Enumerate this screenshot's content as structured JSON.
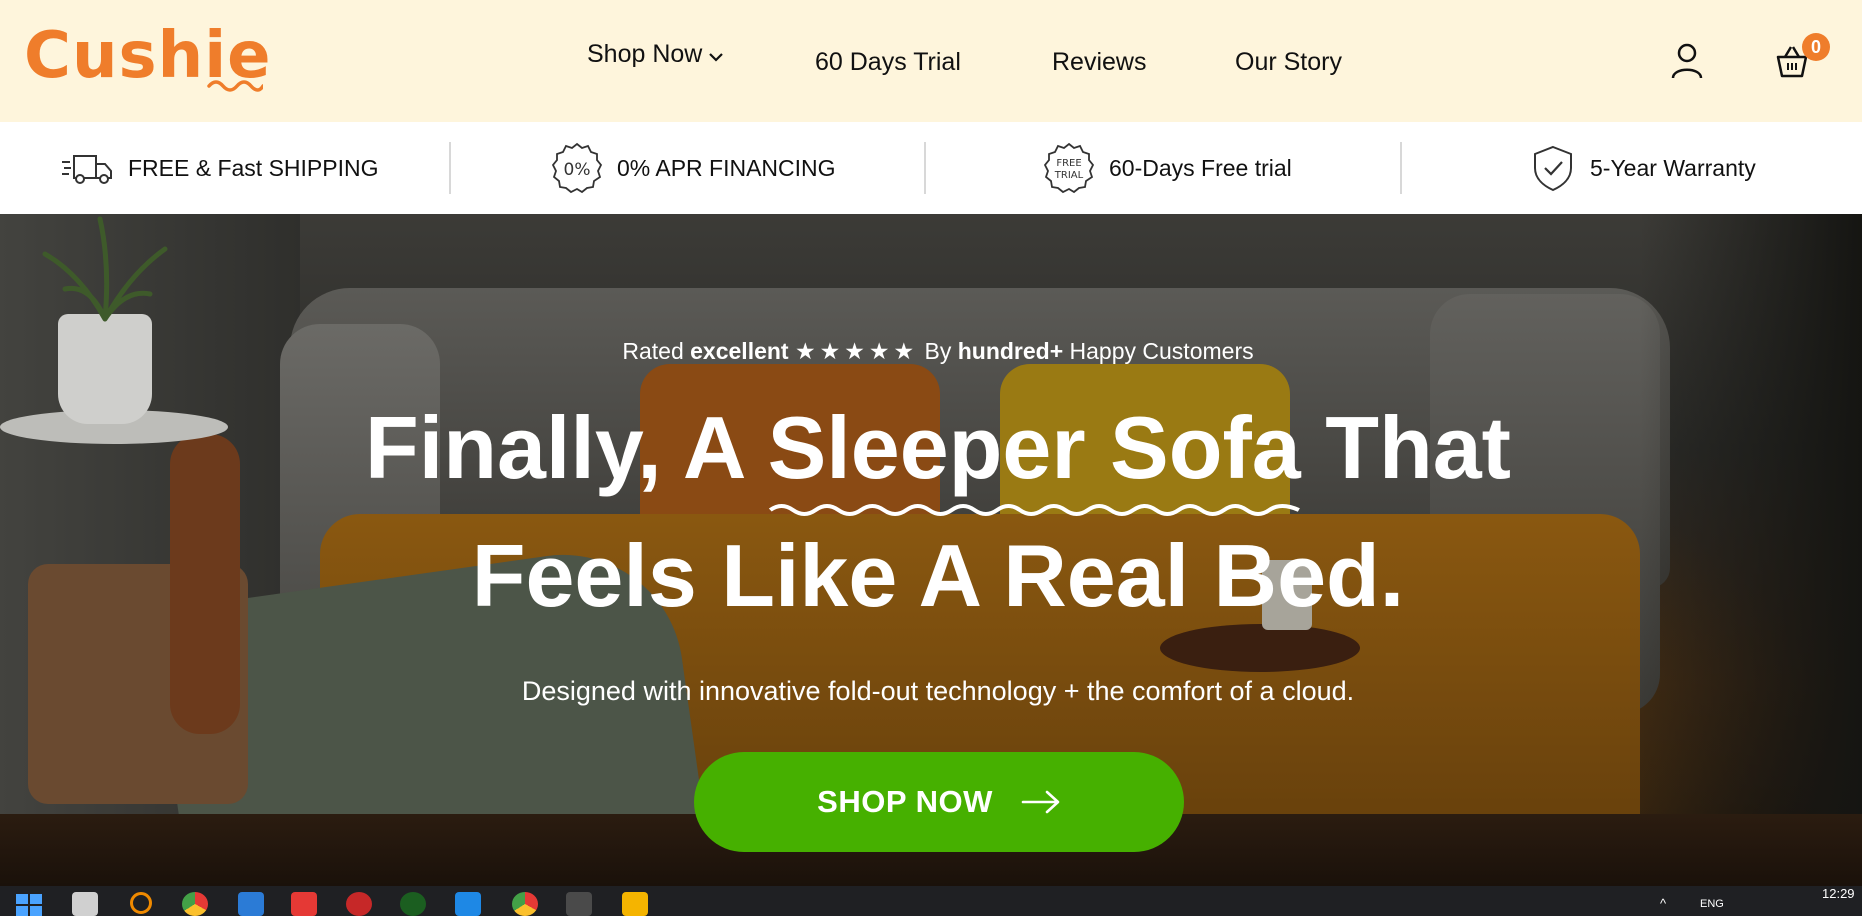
{
  "brand": {
    "name": "Cushie",
    "color": "#ef7d2b"
  },
  "nav": {
    "items": [
      {
        "label": "Shop Now",
        "has_dropdown": true
      },
      {
        "label": "60 Days Trial"
      },
      {
        "label": "Reviews"
      },
      {
        "label": "Our Story"
      }
    ],
    "user_icon": "user-icon",
    "cart_icon": "basket-icon",
    "cart_count": "0"
  },
  "benefits": [
    {
      "icon": "fast-truck-icon",
      "label": "FREE & Fast SHIPPING"
    },
    {
      "icon": "percent-badge-icon",
      "label": "0% APR FINANCING",
      "icon_text": "0%"
    },
    {
      "icon": "free-trial-badge-icon",
      "label": "60-Days Free trial",
      "icon_text": "FREE TRIAL"
    },
    {
      "icon": "shield-check-icon",
      "label": "5-Year Warranty"
    }
  ],
  "hero": {
    "rated_prefix": "Rated",
    "rated_word": "excellent",
    "stars": "★★★★★",
    "by": "By",
    "count_word": "hundred+",
    "rated_suffix": "Happy Customers",
    "headline_part1": "Finally, A",
    "headline_accent": "Sleeper Sofa",
    "headline_part2": "That",
    "headline_line2": "Feels Like A Real Bed.",
    "subtext": "Designed with innovative fold-out technology + the comfort of a cloud.",
    "cta_label": "SHOP NOW",
    "cta_color": "#46b000"
  },
  "taskbar": {
    "language": "ENG",
    "time": "12:29"
  }
}
